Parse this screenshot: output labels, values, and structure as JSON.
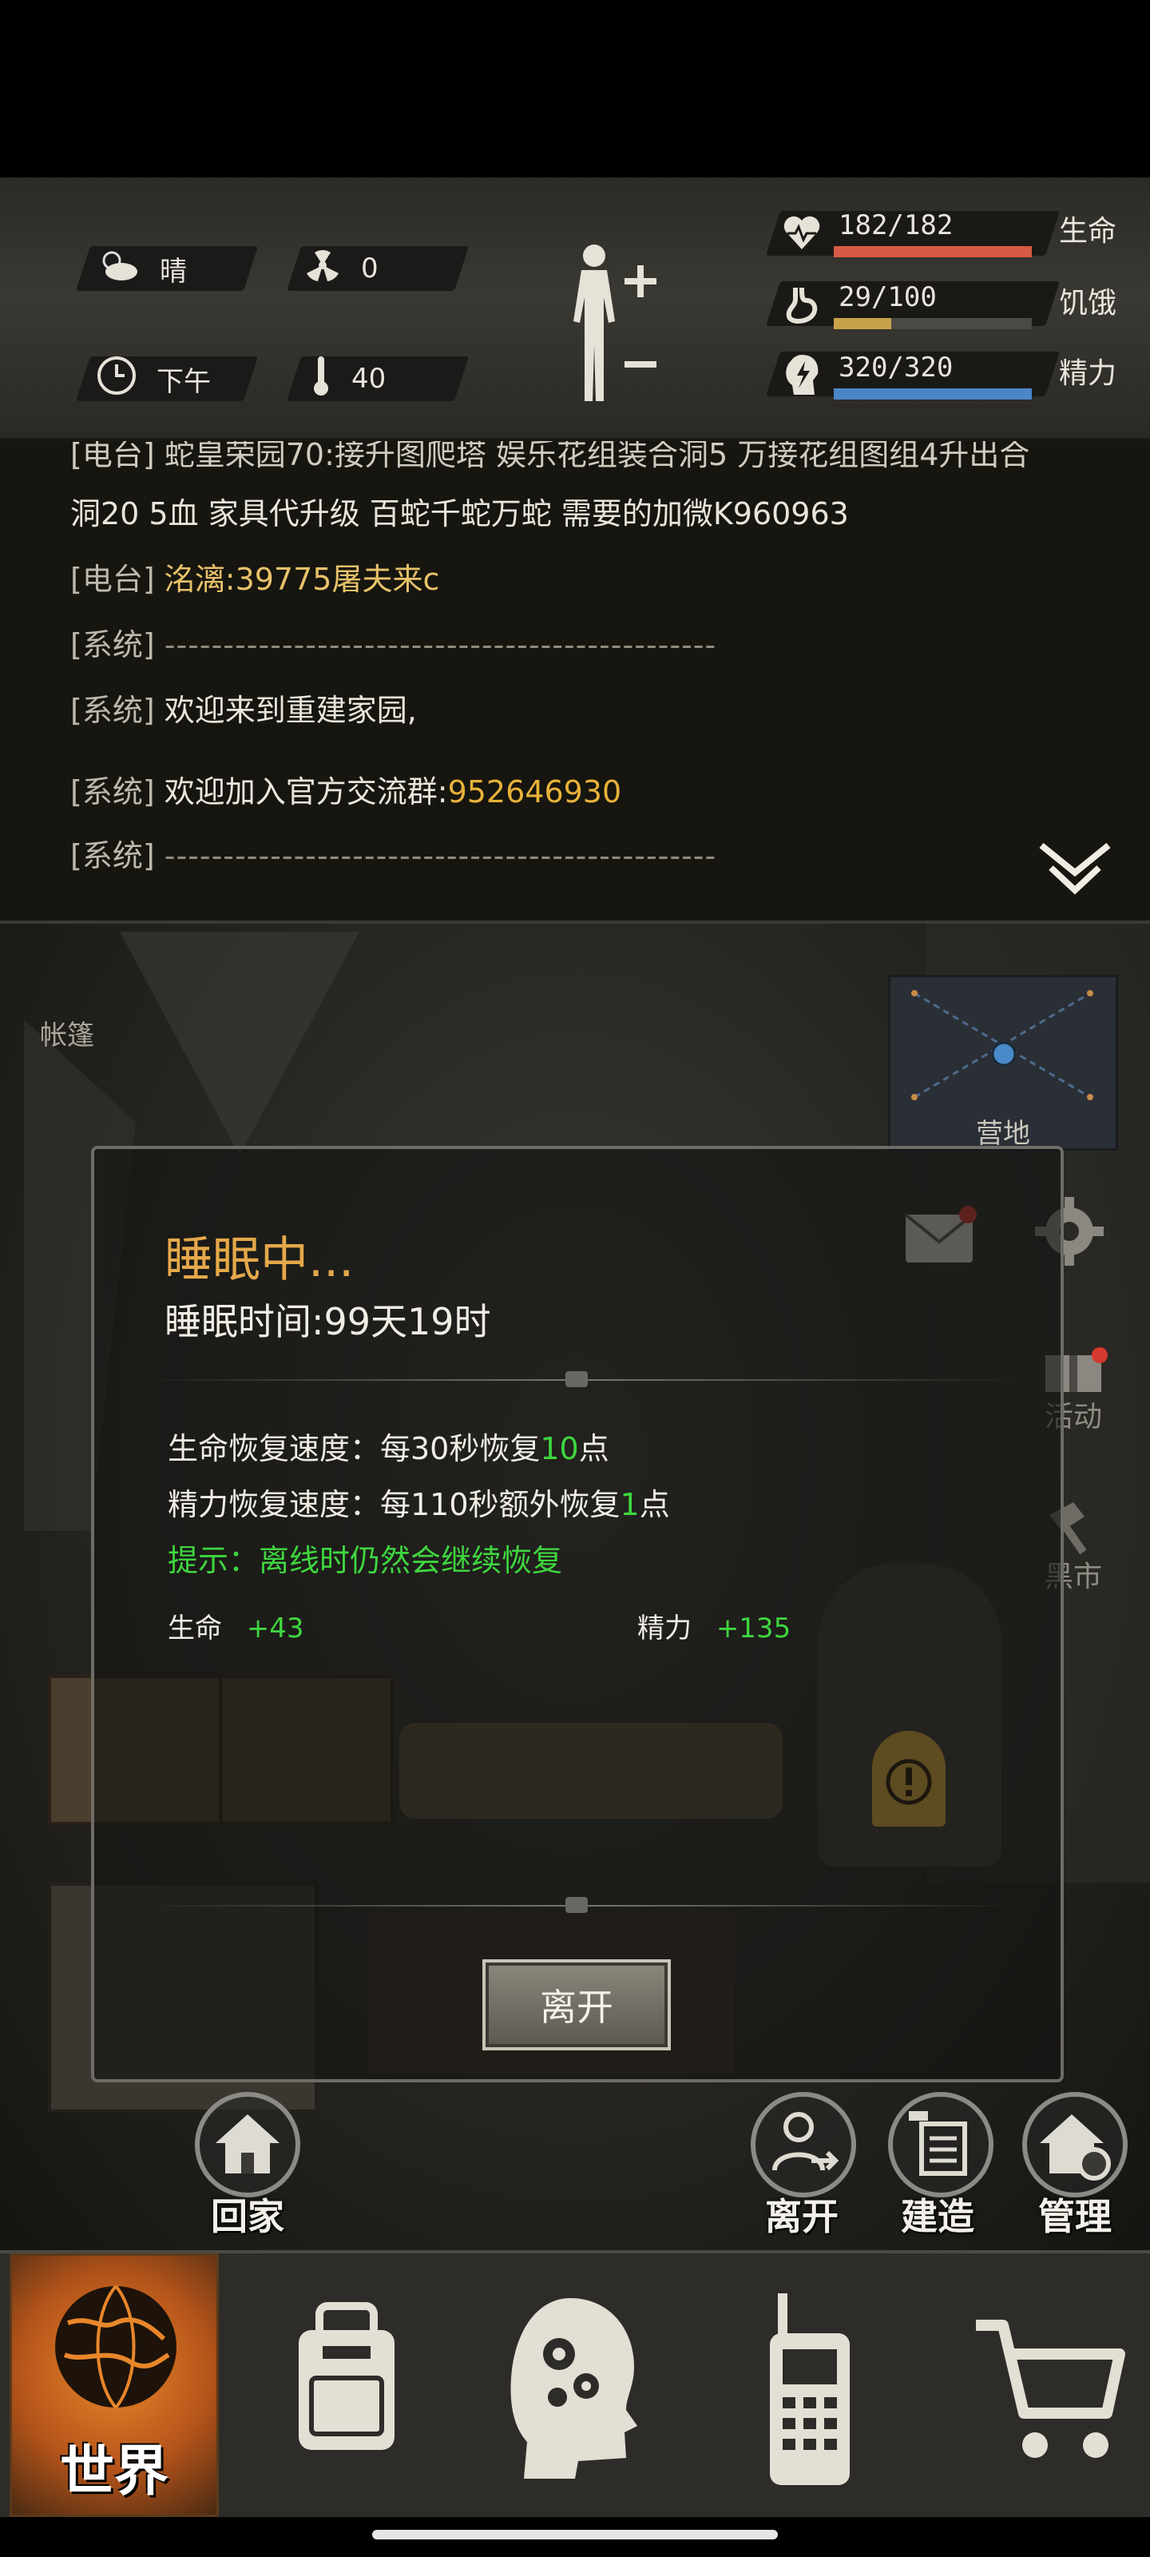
{
  "status": {
    "weather": {
      "icon": "cloud-sun-icon",
      "value": "晴"
    },
    "radiation": {
      "icon": "radiation-icon",
      "value": "0"
    },
    "time_of_day": {
      "icon": "clock-icon",
      "value": "下午"
    },
    "temperature": {
      "icon": "thermometer-icon",
      "value": "40"
    },
    "body_icon": "human-body-icon",
    "stats": [
      {
        "key": "health",
        "icon": "heart-pulse-icon",
        "value": "182/182",
        "label": "生命",
        "fraction": 1.0,
        "color": "#d65a45"
      },
      {
        "key": "hunger",
        "icon": "stomach-icon",
        "value": "29/100",
        "label": "饥饿",
        "fraction": 0.29,
        "color": "#c8a14a"
      },
      {
        "key": "energy",
        "icon": "lightning-head-icon",
        "value": "320/320",
        "label": "精力",
        "fraction": 1.0,
        "color": "#4a86c8"
      }
    ]
  },
  "chat": {
    "lines": [
      {
        "tag": "",
        "speaker": "",
        "text": "[电台] 蛇皇荣园70:接升图爬塔 娱乐花组装合洞5 万接花组图组4升出合",
        "clipped": true
      },
      {
        "tag": "",
        "speaker": "",
        "text": "洞20 5血 家具代升级 百蛇千蛇万蛇 需要的加微K960963"
      },
      {
        "tag": "[电台]",
        "speaker": "洺漓",
        "text": ":39775屠夫来c"
      },
      {
        "tag": "[系统]",
        "speaker": "",
        "text": "-----------------------------------------------"
      },
      {
        "tag": "[系统]",
        "speaker": "",
        "text": "欢迎来到重建家园,"
      },
      {
        "tag": "[系统]",
        "speaker": "",
        "text": "欢迎加入官方交流群:",
        "number": "952646930"
      },
      {
        "tag": "[系统]",
        "speaker": "",
        "text": "-----------------------------------------------"
      }
    ],
    "collapse_icon": "double-chevron-down-icon"
  },
  "scene": {
    "location_label": "帐篷",
    "minimap_label": "营地"
  },
  "modal": {
    "title": "睡眠中...",
    "sleep_time": "睡眠时间:99天19时",
    "health_regen_prefix": "生命恢复速度：每30秒恢复",
    "health_regen_amount": "10",
    "health_regen_suffix": "点",
    "energy_regen_prefix": "精力恢复速度：每110秒额外恢复",
    "energy_regen_amount": "1",
    "energy_regen_suffix": "点",
    "hint": "提示：离线时仍然会继续恢复",
    "health_label": "生命",
    "health_gain": "+43",
    "energy_label": "精力",
    "energy_gain": "+135",
    "leave_button": "离开"
  },
  "side_buttons": {
    "mail_icon": "mail-icon",
    "settings_icon": "gear-icon",
    "activity_label": "活动",
    "black_market_label": "黑市"
  },
  "actions": {
    "home": "回家",
    "leave": "离开",
    "build": "建造",
    "manage": "管理"
  },
  "nav": {
    "world": "世界",
    "items": [
      "backpack-icon",
      "brain-gears-icon",
      "radio-walkie-icon",
      "shopping-cart-icon"
    ]
  }
}
